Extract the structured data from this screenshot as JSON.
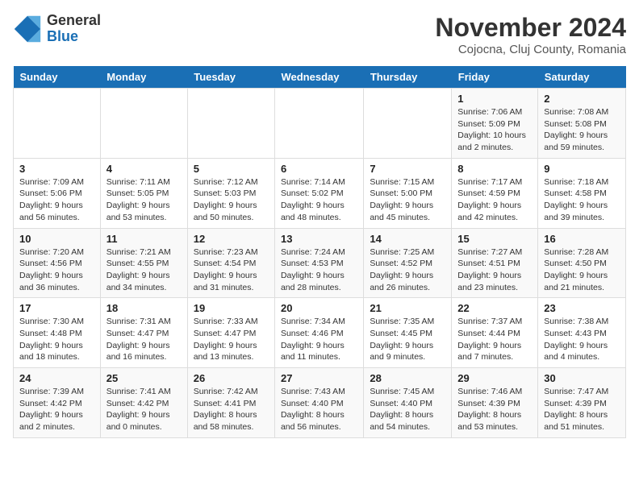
{
  "header": {
    "logo_line1": "General",
    "logo_line2": "Blue",
    "month": "November 2024",
    "location": "Cojocna, Cluj County, Romania"
  },
  "weekdays": [
    "Sunday",
    "Monday",
    "Tuesday",
    "Wednesday",
    "Thursday",
    "Friday",
    "Saturday"
  ],
  "weeks": [
    [
      {
        "day": "",
        "info": ""
      },
      {
        "day": "",
        "info": ""
      },
      {
        "day": "",
        "info": ""
      },
      {
        "day": "",
        "info": ""
      },
      {
        "day": "",
        "info": ""
      },
      {
        "day": "1",
        "info": "Sunrise: 7:06 AM\nSunset: 5:09 PM\nDaylight: 10 hours and 2 minutes."
      },
      {
        "day": "2",
        "info": "Sunrise: 7:08 AM\nSunset: 5:08 PM\nDaylight: 9 hours and 59 minutes."
      }
    ],
    [
      {
        "day": "3",
        "info": "Sunrise: 7:09 AM\nSunset: 5:06 PM\nDaylight: 9 hours and 56 minutes."
      },
      {
        "day": "4",
        "info": "Sunrise: 7:11 AM\nSunset: 5:05 PM\nDaylight: 9 hours and 53 minutes."
      },
      {
        "day": "5",
        "info": "Sunrise: 7:12 AM\nSunset: 5:03 PM\nDaylight: 9 hours and 50 minutes."
      },
      {
        "day": "6",
        "info": "Sunrise: 7:14 AM\nSunset: 5:02 PM\nDaylight: 9 hours and 48 minutes."
      },
      {
        "day": "7",
        "info": "Sunrise: 7:15 AM\nSunset: 5:00 PM\nDaylight: 9 hours and 45 minutes."
      },
      {
        "day": "8",
        "info": "Sunrise: 7:17 AM\nSunset: 4:59 PM\nDaylight: 9 hours and 42 minutes."
      },
      {
        "day": "9",
        "info": "Sunrise: 7:18 AM\nSunset: 4:58 PM\nDaylight: 9 hours and 39 minutes."
      }
    ],
    [
      {
        "day": "10",
        "info": "Sunrise: 7:20 AM\nSunset: 4:56 PM\nDaylight: 9 hours and 36 minutes."
      },
      {
        "day": "11",
        "info": "Sunrise: 7:21 AM\nSunset: 4:55 PM\nDaylight: 9 hours and 34 minutes."
      },
      {
        "day": "12",
        "info": "Sunrise: 7:23 AM\nSunset: 4:54 PM\nDaylight: 9 hours and 31 minutes."
      },
      {
        "day": "13",
        "info": "Sunrise: 7:24 AM\nSunset: 4:53 PM\nDaylight: 9 hours and 28 minutes."
      },
      {
        "day": "14",
        "info": "Sunrise: 7:25 AM\nSunset: 4:52 PM\nDaylight: 9 hours and 26 minutes."
      },
      {
        "day": "15",
        "info": "Sunrise: 7:27 AM\nSunset: 4:51 PM\nDaylight: 9 hours and 23 minutes."
      },
      {
        "day": "16",
        "info": "Sunrise: 7:28 AM\nSunset: 4:50 PM\nDaylight: 9 hours and 21 minutes."
      }
    ],
    [
      {
        "day": "17",
        "info": "Sunrise: 7:30 AM\nSunset: 4:48 PM\nDaylight: 9 hours and 18 minutes."
      },
      {
        "day": "18",
        "info": "Sunrise: 7:31 AM\nSunset: 4:47 PM\nDaylight: 9 hours and 16 minutes."
      },
      {
        "day": "19",
        "info": "Sunrise: 7:33 AM\nSunset: 4:47 PM\nDaylight: 9 hours and 13 minutes."
      },
      {
        "day": "20",
        "info": "Sunrise: 7:34 AM\nSunset: 4:46 PM\nDaylight: 9 hours and 11 minutes."
      },
      {
        "day": "21",
        "info": "Sunrise: 7:35 AM\nSunset: 4:45 PM\nDaylight: 9 hours and 9 minutes."
      },
      {
        "day": "22",
        "info": "Sunrise: 7:37 AM\nSunset: 4:44 PM\nDaylight: 9 hours and 7 minutes."
      },
      {
        "day": "23",
        "info": "Sunrise: 7:38 AM\nSunset: 4:43 PM\nDaylight: 9 hours and 4 minutes."
      }
    ],
    [
      {
        "day": "24",
        "info": "Sunrise: 7:39 AM\nSunset: 4:42 PM\nDaylight: 9 hours and 2 minutes."
      },
      {
        "day": "25",
        "info": "Sunrise: 7:41 AM\nSunset: 4:42 PM\nDaylight: 9 hours and 0 minutes."
      },
      {
        "day": "26",
        "info": "Sunrise: 7:42 AM\nSunset: 4:41 PM\nDaylight: 8 hours and 58 minutes."
      },
      {
        "day": "27",
        "info": "Sunrise: 7:43 AM\nSunset: 4:40 PM\nDaylight: 8 hours and 56 minutes."
      },
      {
        "day": "28",
        "info": "Sunrise: 7:45 AM\nSunset: 4:40 PM\nDaylight: 8 hours and 54 minutes."
      },
      {
        "day": "29",
        "info": "Sunrise: 7:46 AM\nSunset: 4:39 PM\nDaylight: 8 hours and 53 minutes."
      },
      {
        "day": "30",
        "info": "Sunrise: 7:47 AM\nSunset: 4:39 PM\nDaylight: 8 hours and 51 minutes."
      }
    ]
  ]
}
